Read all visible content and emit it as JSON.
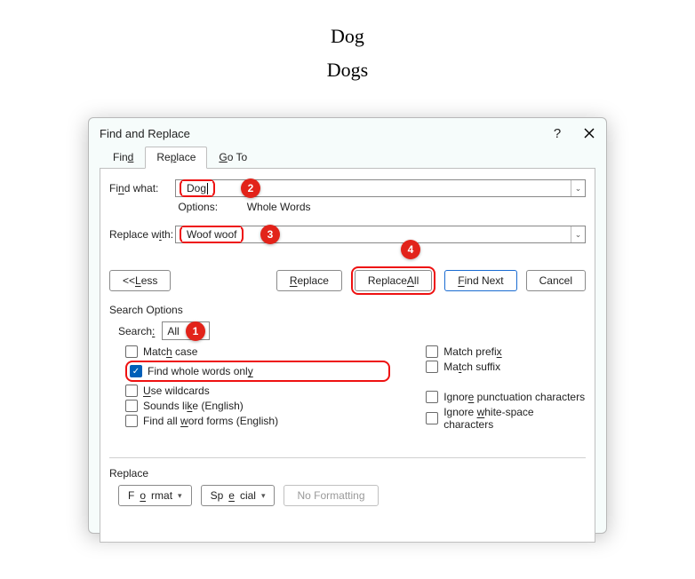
{
  "document": {
    "line1": "Dog",
    "line2": "Dogs"
  },
  "dialog": {
    "title": "Find and Replace",
    "help": "?",
    "tabs": {
      "find": "Find",
      "replace": "Replace",
      "goto": "Go To",
      "active": "replace"
    },
    "findwhat_label": "Find what:",
    "findwhat_value": "Dog",
    "options_label": "Options:",
    "options_value": "Whole Words",
    "replacewith_label": "Replace with:",
    "replacewith_value": "Woof woof",
    "buttons": {
      "less": "<< Less",
      "replace": "Replace",
      "replace_all": "Replace All",
      "find_next": "Find Next",
      "cancel": "Cancel"
    },
    "search_options_title": "Search Options",
    "search_label": "Search:",
    "search_value": "All",
    "checks": {
      "match_case": "Match case",
      "whole_words": "Find whole words only",
      "wildcards": "Use wildcards",
      "sounds_like": "Sounds like (English)",
      "word_forms": "Find all word forms (English)",
      "match_prefix": "Match prefix",
      "match_suffix": "Match suffix",
      "ignore_punct": "Ignore punctuation characters",
      "ignore_white": "Ignore white-space characters",
      "whole_words_checked": true
    },
    "replace_title": "Replace",
    "format_btn": "Format",
    "special_btn": "Special",
    "no_formatting": "No Formatting"
  },
  "callouts": {
    "b1": "1",
    "b2": "2",
    "b3": "3",
    "b4": "4"
  }
}
